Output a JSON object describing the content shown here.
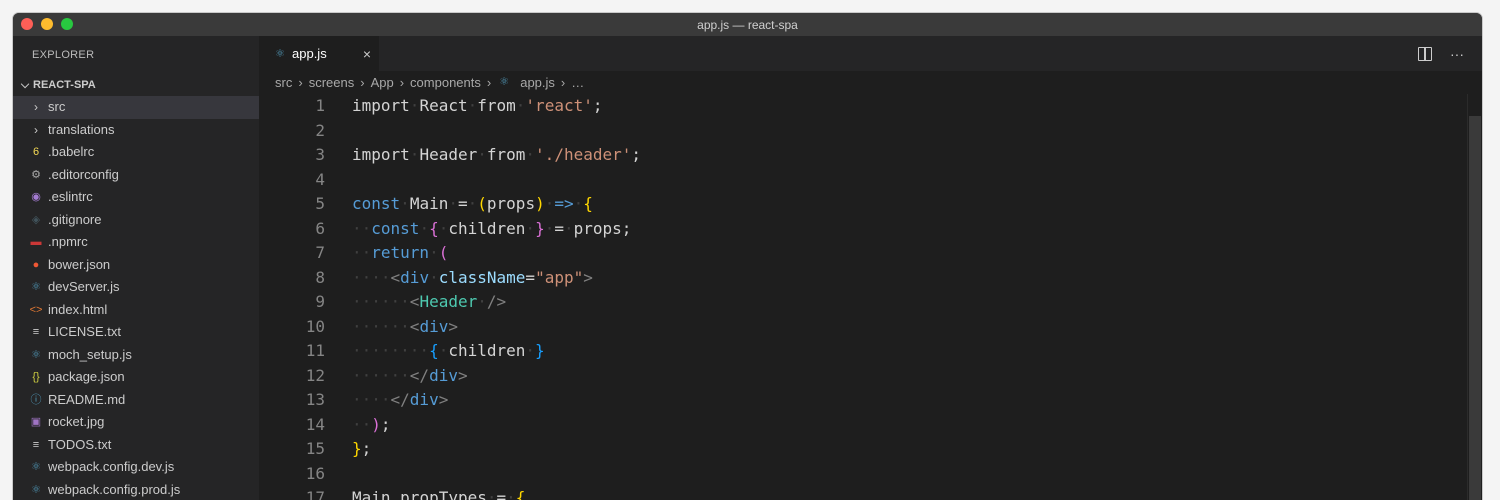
{
  "window": {
    "title": "app.js — react-spa"
  },
  "explorer": {
    "header": "EXPLORER",
    "folder": "REACT-SPA",
    "items": [
      {
        "label": "src",
        "kind": "folder",
        "icon": "chevron-right"
      },
      {
        "label": "translations",
        "kind": "folder",
        "icon": "chevron-right"
      },
      {
        "label": ".babelrc",
        "kind": "file",
        "icon": "babel-icon",
        "color": "#f5da55"
      },
      {
        "label": ".editorconfig",
        "kind": "file",
        "icon": "gear-icon",
        "color": "#a9a9a9"
      },
      {
        "label": ".eslintrc",
        "kind": "file",
        "icon": "eslint-icon",
        "color": "#a57cd3"
      },
      {
        "label": ".gitignore",
        "kind": "file",
        "icon": "git-icon",
        "color": "#41535b"
      },
      {
        "label": ".npmrc",
        "kind": "file",
        "icon": "npm-icon",
        "color": "#cb3837"
      },
      {
        "label": "bower.json",
        "kind": "file",
        "icon": "bower-icon",
        "color": "#ef5734"
      },
      {
        "label": "devServer.js",
        "kind": "file",
        "icon": "react-icon",
        "color": "#519aba"
      },
      {
        "label": "index.html",
        "kind": "file",
        "icon": "html-icon",
        "color": "#e37933"
      },
      {
        "label": "LICENSE.txt",
        "kind": "file",
        "icon": "lines-icon",
        "color": "#cccccc"
      },
      {
        "label": "moch_setup.js",
        "kind": "file",
        "icon": "react-icon",
        "color": "#519aba"
      },
      {
        "label": "package.json",
        "kind": "file",
        "icon": "json-icon",
        "color": "#cbcb41"
      },
      {
        "label": "README.md",
        "kind": "file",
        "icon": "info-icon",
        "color": "#519aba"
      },
      {
        "label": "rocket.jpg",
        "kind": "file",
        "icon": "image-icon",
        "color": "#a074c4"
      },
      {
        "label": "TODOS.txt",
        "kind": "file",
        "icon": "lines-icon",
        "color": "#cccccc"
      },
      {
        "label": "webpack.config.dev.js",
        "kind": "file",
        "icon": "react-icon",
        "color": "#519aba"
      },
      {
        "label": "webpack.config.prod.js",
        "kind": "file",
        "icon": "react-icon",
        "color": "#519aba"
      }
    ]
  },
  "tab": {
    "label": "app.js",
    "close": "×"
  },
  "tab_actions": {
    "more": "···"
  },
  "breadcrumb": {
    "parts": [
      "src",
      "screens",
      "App",
      "components"
    ],
    "file": "app.js",
    "ellipsis": "…"
  },
  "code": {
    "lines": [
      [
        [
          "import",
          "def"
        ],
        [
          " ",
          "ws-sp"
        ],
        [
          "React",
          "def"
        ],
        [
          " ",
          "ws-sp"
        ],
        [
          "from",
          "def"
        ],
        [
          " ",
          "ws-sp"
        ],
        [
          "'react'",
          "str"
        ],
        [
          ";",
          "def"
        ]
      ],
      [],
      [
        [
          "import",
          "def"
        ],
        [
          " ",
          "ws-sp"
        ],
        [
          "Header",
          "def"
        ],
        [
          " ",
          "ws-sp"
        ],
        [
          "from",
          "def"
        ],
        [
          " ",
          "ws-sp"
        ],
        [
          "'./header'",
          "str"
        ],
        [
          ";",
          "def"
        ]
      ],
      [],
      [
        [
          "const",
          "kw"
        ],
        [
          " ",
          "ws-sp"
        ],
        [
          "Main",
          "def"
        ],
        [
          " ",
          "ws-sp"
        ],
        [
          "=",
          "def"
        ],
        [
          " ",
          "ws-sp"
        ],
        [
          "(",
          "br1"
        ],
        [
          "props",
          "def"
        ],
        [
          ")",
          "br1"
        ],
        [
          " ",
          "ws-sp"
        ],
        [
          "=>",
          "kw"
        ],
        [
          " ",
          "ws-sp"
        ],
        [
          "{",
          "br1"
        ]
      ],
      [
        [
          "··",
          "ws"
        ],
        [
          "const",
          "kw"
        ],
        [
          " ",
          "ws-sp"
        ],
        [
          "{",
          "br2"
        ],
        [
          " ",
          "ws-sp"
        ],
        [
          "children",
          "def"
        ],
        [
          " ",
          "ws-sp"
        ],
        [
          "}",
          "br2"
        ],
        [
          " ",
          "ws-sp"
        ],
        [
          "=",
          "def"
        ],
        [
          " ",
          "ws-sp"
        ],
        [
          "props",
          "def"
        ],
        [
          ";",
          "def"
        ]
      ],
      [
        [
          "··",
          "ws"
        ],
        [
          "return",
          "kw"
        ],
        [
          " ",
          "ws-sp"
        ],
        [
          "(",
          "br2"
        ]
      ],
      [
        [
          "····",
          "ws"
        ],
        [
          "<",
          "punct"
        ],
        [
          "div",
          "tag"
        ],
        [
          " ",
          "ws-sp"
        ],
        [
          "className",
          "attr"
        ],
        [
          "=",
          "def"
        ],
        [
          "\"app\"",
          "str"
        ],
        [
          ">",
          "punct"
        ]
      ],
      [
        [
          "······",
          "ws"
        ],
        [
          "<",
          "punct"
        ],
        [
          "Header",
          "comp"
        ],
        [
          " ",
          "ws-sp"
        ],
        [
          "/>",
          "punct"
        ]
      ],
      [
        [
          "······",
          "ws"
        ],
        [
          "<",
          "punct"
        ],
        [
          "div",
          "tag"
        ],
        [
          ">",
          "punct"
        ]
      ],
      [
        [
          "········",
          "ws"
        ],
        [
          "{",
          "br3"
        ],
        [
          " ",
          "ws-sp"
        ],
        [
          "children",
          "def"
        ],
        [
          " ",
          "ws-sp"
        ],
        [
          "}",
          "br3"
        ]
      ],
      [
        [
          "······",
          "ws"
        ],
        [
          "</",
          "punct"
        ],
        [
          "div",
          "tag"
        ],
        [
          ">",
          "punct"
        ]
      ],
      [
        [
          "····",
          "ws"
        ],
        [
          "</",
          "punct"
        ],
        [
          "div",
          "tag"
        ],
        [
          ">",
          "punct"
        ]
      ],
      [
        [
          "··",
          "ws"
        ],
        [
          ")",
          "br2"
        ],
        [
          ";",
          "def"
        ]
      ],
      [
        [
          "}",
          "br1"
        ],
        [
          ";",
          "def"
        ]
      ],
      [],
      [
        [
          "Main",
          "def"
        ],
        [
          ".",
          "def"
        ],
        [
          "propTypes",
          "def"
        ],
        [
          " ",
          "ws-sp"
        ],
        [
          "=",
          "def"
        ],
        [
          " ",
          "ws-sp"
        ],
        [
          "{",
          "br1"
        ]
      ]
    ]
  }
}
